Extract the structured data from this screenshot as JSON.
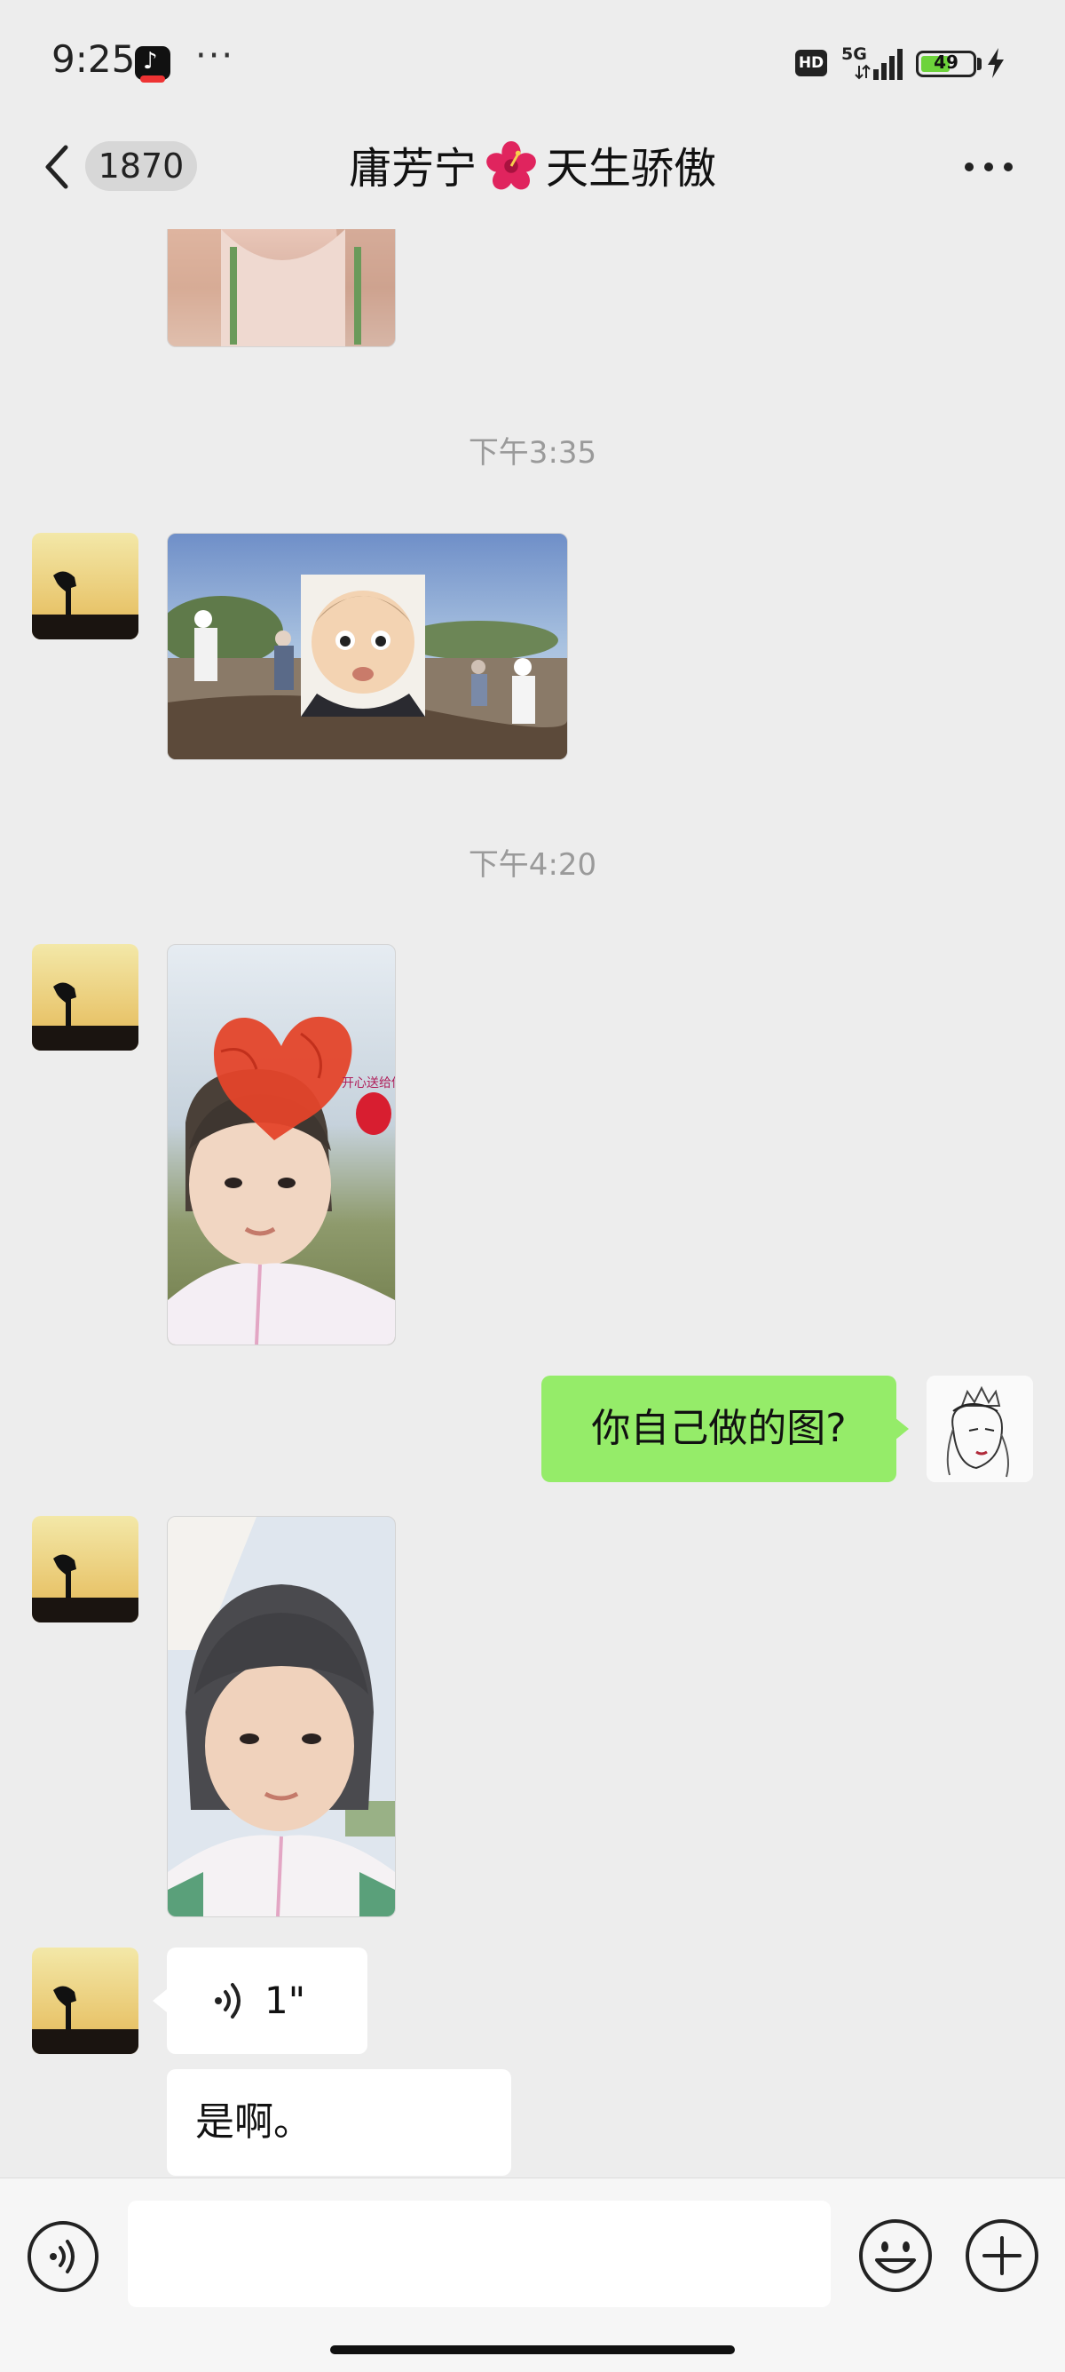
{
  "status_bar": {
    "time": "9:25",
    "overflow": "···",
    "hd": "HD",
    "network": "5G",
    "battery": "49",
    "battery_level_percent": 49
  },
  "nav": {
    "unread_count": "1870",
    "title_left": "庸芳宁",
    "title_right": "天生骄傲",
    "title_emoji_icon": "hibiscus-icon",
    "back_icon": "chevron-left-icon",
    "more_icon": "more-horizontal-icon"
  },
  "chat": {
    "timestamps": [
      "下午3:35",
      "下午4:20"
    ],
    "my_message": "你自己做的图?",
    "voice_duration": "1\"",
    "text_reply": "是啊。"
  },
  "input_bar": {
    "placeholder": "",
    "voice_icon": "voice-mode-icon",
    "emoji_icon": "emoji-icon",
    "plus_icon": "plus-circle-icon"
  },
  "colors": {
    "background": "#ededed",
    "my_bubble": "#95ec69",
    "other_bubble": "#ffffff",
    "timestamp": "#9a9a9a"
  }
}
